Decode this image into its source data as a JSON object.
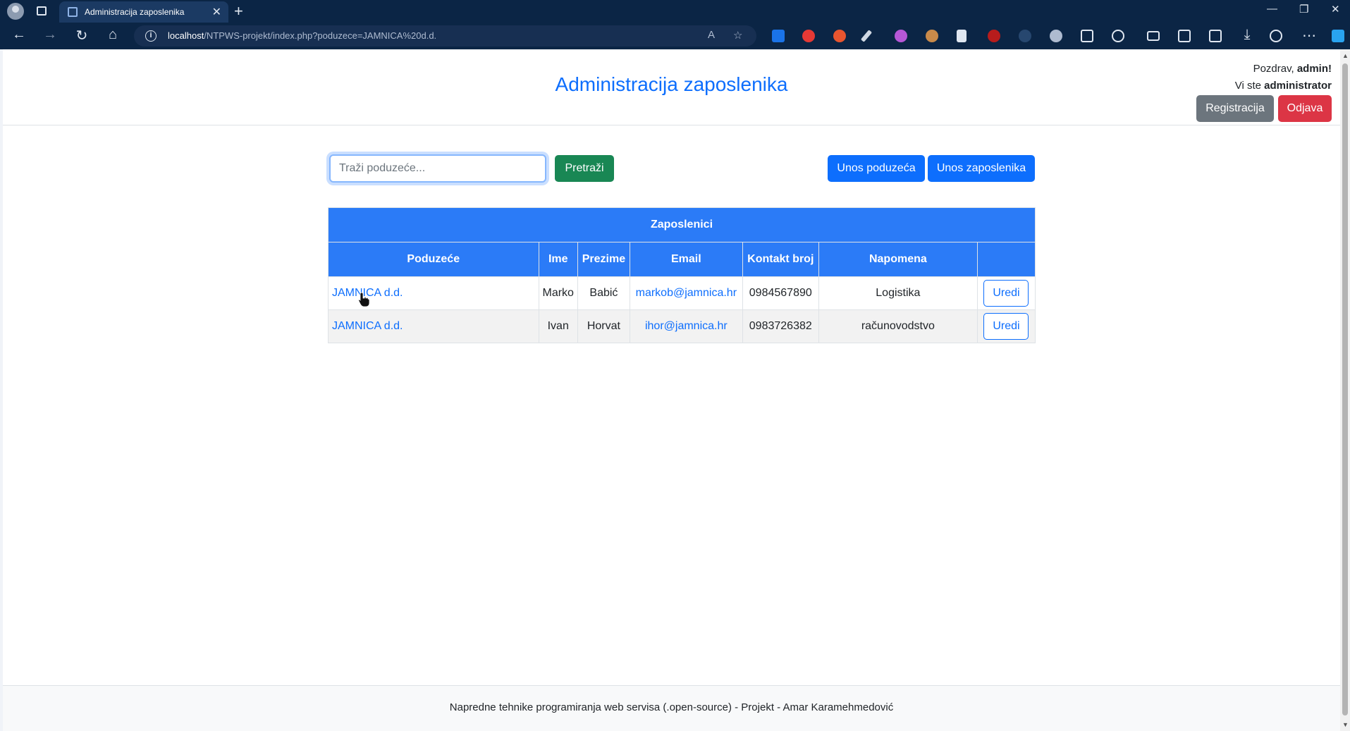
{
  "browser": {
    "tab_title": "Administracija zaposlenika",
    "url_host": "localhost",
    "url_path": "/NTPWS-projekt/index.php?poduzece=JAMNICA%20d.d."
  },
  "colors": {
    "primary": "#0d6efd",
    "table_header": "#2b7bf7",
    "success": "#198754",
    "danger": "#dc3545",
    "secondary": "#6c757d"
  },
  "header": {
    "title": "Administracija zaposlenika",
    "greeting_prefix": "Pozdrav,",
    "username": "admin!",
    "role_prefix": "Vi ste",
    "role": "administrator",
    "register_label": "Registracija",
    "logout_label": "Odjava"
  },
  "toolbar": {
    "search_placeholder": "Traži poduzeće...",
    "search_value": "",
    "search_button": "Pretraži",
    "add_company_label": "Unos poduzeća",
    "add_employee_label": "Unos zaposlenika"
  },
  "table": {
    "caption": "Zaposlenici",
    "columns": [
      "Poduzeće",
      "Ime",
      "Prezime",
      "Email",
      "Kontakt broj",
      "Napomena",
      ""
    ],
    "rows": [
      {
        "company": "JAMNICA d.d.",
        "first_name": "Marko",
        "last_name": "Babić",
        "email": "markob@jamnica.hr",
        "phone": "0984567890",
        "note": "Logistika",
        "action": "Uredi"
      },
      {
        "company": "JAMNICA d.d.",
        "first_name": "Ivan",
        "last_name": "Horvat",
        "email": "ihor@jamnica.hr",
        "phone": "0983726382",
        "note": "računovodstvo",
        "action": "Uredi"
      }
    ]
  },
  "footer": {
    "text": "Napredne tehnike programiranja web servisa (.open-source) - Projekt - Amar Karamehmedović"
  }
}
